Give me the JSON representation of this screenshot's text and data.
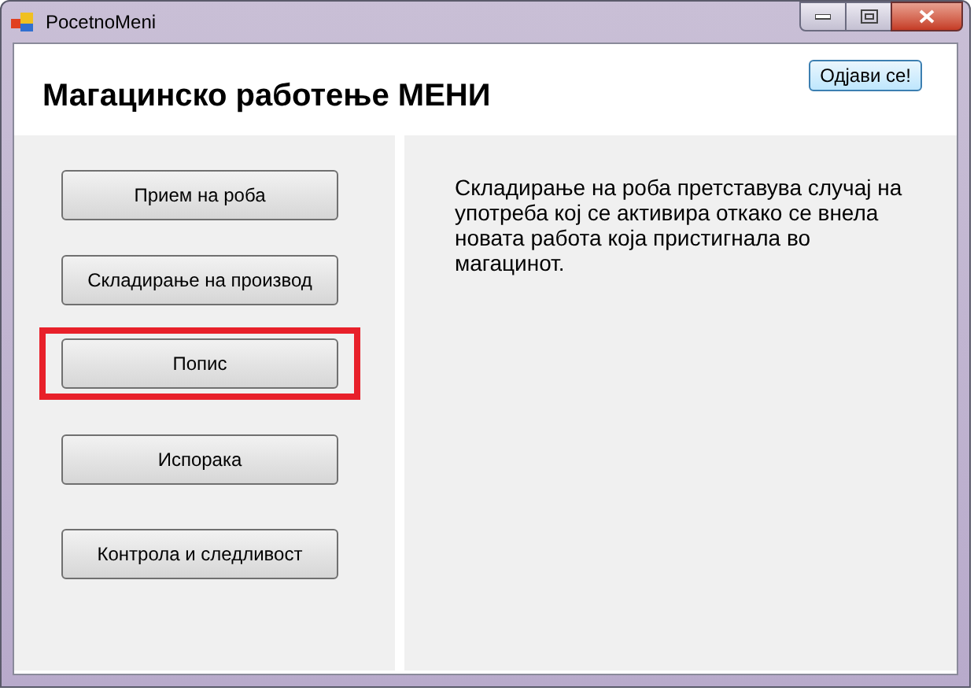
{
  "window": {
    "title": "PocetnoMeni"
  },
  "header": {
    "title": "Магацинско работење МЕНИ",
    "logout_button": "Одјави се!"
  },
  "menu_buttons": [
    {
      "label": "Прием на роба",
      "highlighted": false
    },
    {
      "label": "Складирање на производ",
      "highlighted": false
    },
    {
      "label": "Попис",
      "highlighted": true
    },
    {
      "label": "Испорака",
      "highlighted": false
    },
    {
      "label": "Контрола и следливост",
      "highlighted": false
    }
  ],
  "description": "Складирање на роба претставува случај на употреба кој се активира откако се внела новата работа која пристигнала во магацинот."
}
